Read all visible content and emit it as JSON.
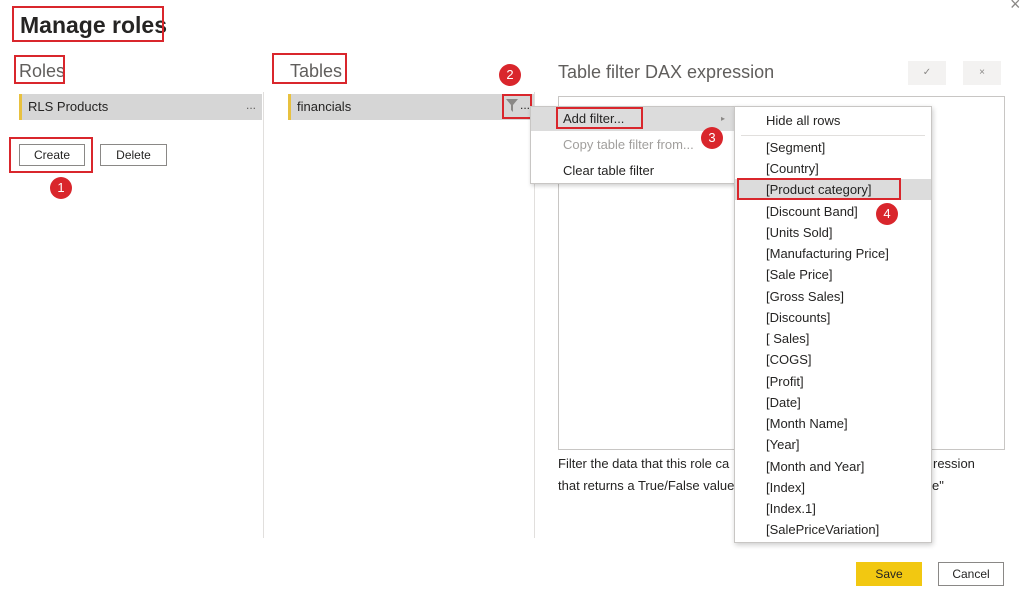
{
  "window": {
    "title": "Manage roles",
    "close_glyph": "×"
  },
  "roles": {
    "heading": "Roles",
    "items": [
      {
        "label": "RLS Products",
        "more": "..."
      }
    ],
    "create_label": "Create",
    "delete_label": "Delete"
  },
  "tables": {
    "heading": "Tables",
    "items": [
      {
        "label": "financials",
        "more": "..."
      }
    ]
  },
  "context_menu": {
    "items": [
      {
        "label": "Add filter...",
        "state": "highlighted",
        "has_submenu": true
      },
      {
        "label": "Copy table filter from...",
        "state": "disabled"
      },
      {
        "label": "Clear table filter",
        "state": "normal"
      }
    ]
  },
  "submenu": {
    "items": [
      "Hide all rows",
      "[Segment]",
      "[Country]",
      "[Product category]",
      "[Discount Band]",
      "[Units Sold]",
      "[Manufacturing Price]",
      "[Sale Price]",
      "[Gross Sales]",
      "[Discounts]",
      "[ Sales]",
      "[COGS]",
      "[Profit]",
      "[Date]",
      "[Month Name]",
      "[Year]",
      "[Month and Year]",
      "[Index]",
      "[Index.1]",
      "[SalePriceVariation]"
    ],
    "highlighted": "[Product category]"
  },
  "dax": {
    "heading": "Table filter DAX expression",
    "confirm_glyph": "✓",
    "cancel_glyph": "×",
    "description_line1_left": "Filter the data that this role ca",
    "description_line1_right": "ression",
    "description_line2_left": "that returns a True/False value",
    "description_line2_right": "e\""
  },
  "footer": {
    "save_label": "Save",
    "cancel_label": "Cancel"
  },
  "annotations": {
    "step1": "1",
    "step2": "2",
    "step3": "3",
    "step4": "4"
  },
  "colors": {
    "annotation_red": "#d9262c",
    "accent_yellow": "#f2c811",
    "row_marker": "#e8c13f"
  }
}
